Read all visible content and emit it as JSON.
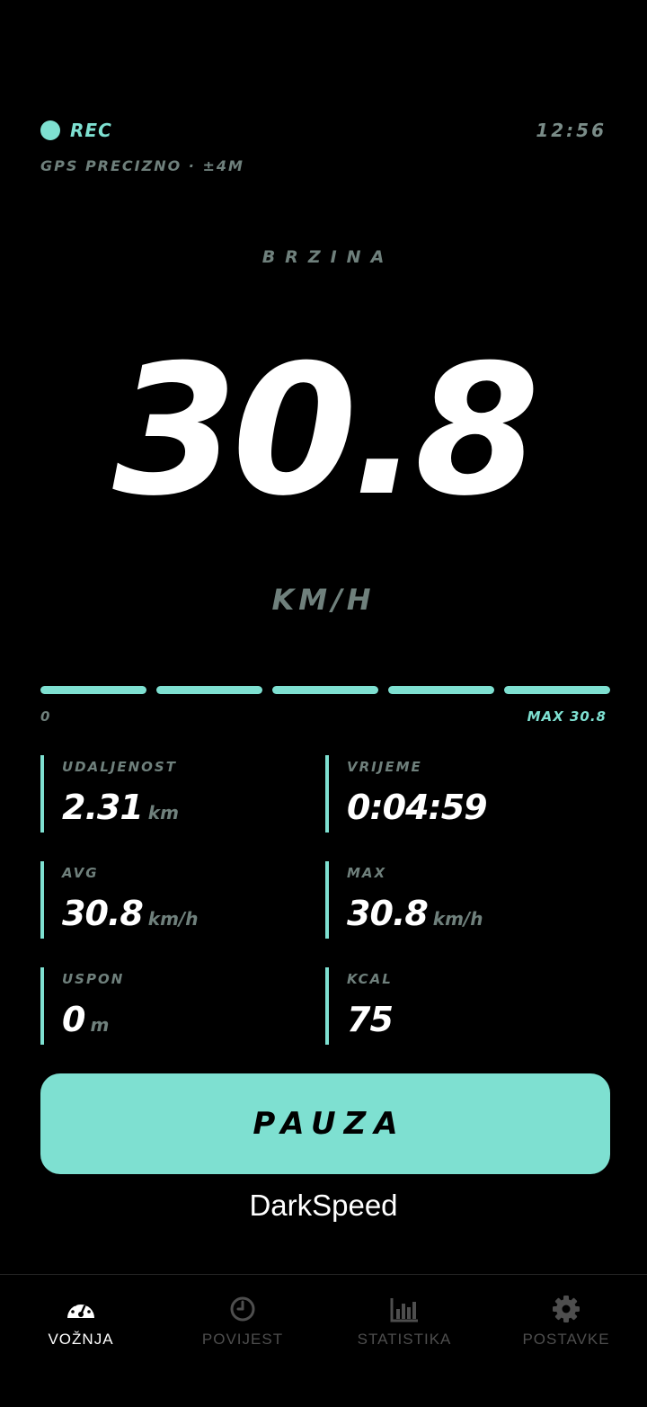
{
  "status": {
    "rec_label": "REC",
    "clock": "12:56",
    "gps": "GPS PRECIZNO · ±4M"
  },
  "speed": {
    "label": "BRZINA",
    "value": "30.8",
    "unit": "KM/H",
    "bar_min_label": "0",
    "bar_max_label": "MAX 30.8",
    "bar_fill_fraction": 1.0
  },
  "stats": [
    {
      "label": "UDALJENOST",
      "value": "2.31",
      "unit": "km"
    },
    {
      "label": "VRIJEME",
      "value": "0:04:59",
      "unit": ""
    },
    {
      "label": "AVG",
      "value": "30.8",
      "unit": "km/h"
    },
    {
      "label": "MAX",
      "value": "30.8",
      "unit": "km/h"
    },
    {
      "label": "USPON",
      "value": "0",
      "unit": "m"
    },
    {
      "label": "KCAL",
      "value": "75",
      "unit": ""
    }
  ],
  "pause_label": "PAUZA",
  "app_name": "DarkSpeed",
  "nav": [
    {
      "label": "VOŽNJA",
      "icon": "speedometer-icon",
      "active": true
    },
    {
      "label": "POVIJEST",
      "icon": "clock-icon",
      "active": false
    },
    {
      "label": "STATISTIKA",
      "icon": "bar-chart-icon",
      "active": false
    },
    {
      "label": "POSTAVKE",
      "icon": "gear-icon",
      "active": false
    }
  ],
  "colors": {
    "accent": "#7ee0d1",
    "muted": "#6f807c",
    "background": "#000000",
    "nav_inactive": "#4e4e4e"
  }
}
